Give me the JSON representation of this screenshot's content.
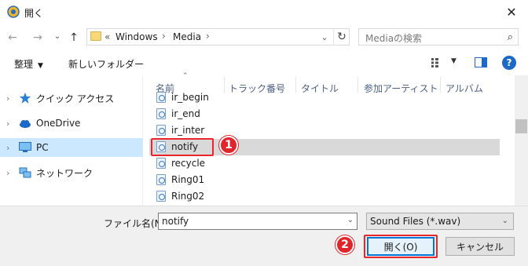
{
  "window": {
    "title": "開く",
    "close_glyph": "✕"
  },
  "nav": {
    "back_glyph": "←",
    "forward_glyph": "→",
    "dropdown_glyph": "⌄",
    "up_glyph": "↑",
    "breadcrumb": {
      "overflow": "«",
      "parts": [
        "Windows",
        "Media"
      ],
      "sep": "›"
    },
    "refresh_glyph": "↻",
    "search_placeholder": "Mediaの検索",
    "search_glyph": "⌕"
  },
  "toolbar": {
    "organize": "整理",
    "new_folder": "新しいフォルダー",
    "help": "?"
  },
  "sidebar": {
    "items": [
      {
        "label": "クイック アクセス",
        "icon": "star-icon"
      },
      {
        "label": "OneDrive",
        "icon": "cloud-icon"
      },
      {
        "label": "PC",
        "icon": "monitor-icon"
      },
      {
        "label": "ネットワーク",
        "icon": "network-icon"
      }
    ]
  },
  "columns": [
    "名前",
    "トラック番号",
    "タイトル",
    "参加アーティスト",
    "アルバム"
  ],
  "files": [
    "ir_begin",
    "ir_end",
    "ir_inter",
    "notify",
    "recycle",
    "Ring01",
    "Ring02"
  ],
  "selected_file": "notify",
  "bottom": {
    "filename_label": "ファイル名(N):",
    "filename_value": "notify",
    "filetype_value": "Sound Files (*.wav)",
    "open_label": "開く(O)",
    "cancel_label": "キャンセル"
  },
  "callouts": {
    "step1": "1",
    "step2": "2"
  },
  "colors": {
    "callout": "#e0262b",
    "selection": "#cce8ff",
    "accent": "#0078d7"
  }
}
